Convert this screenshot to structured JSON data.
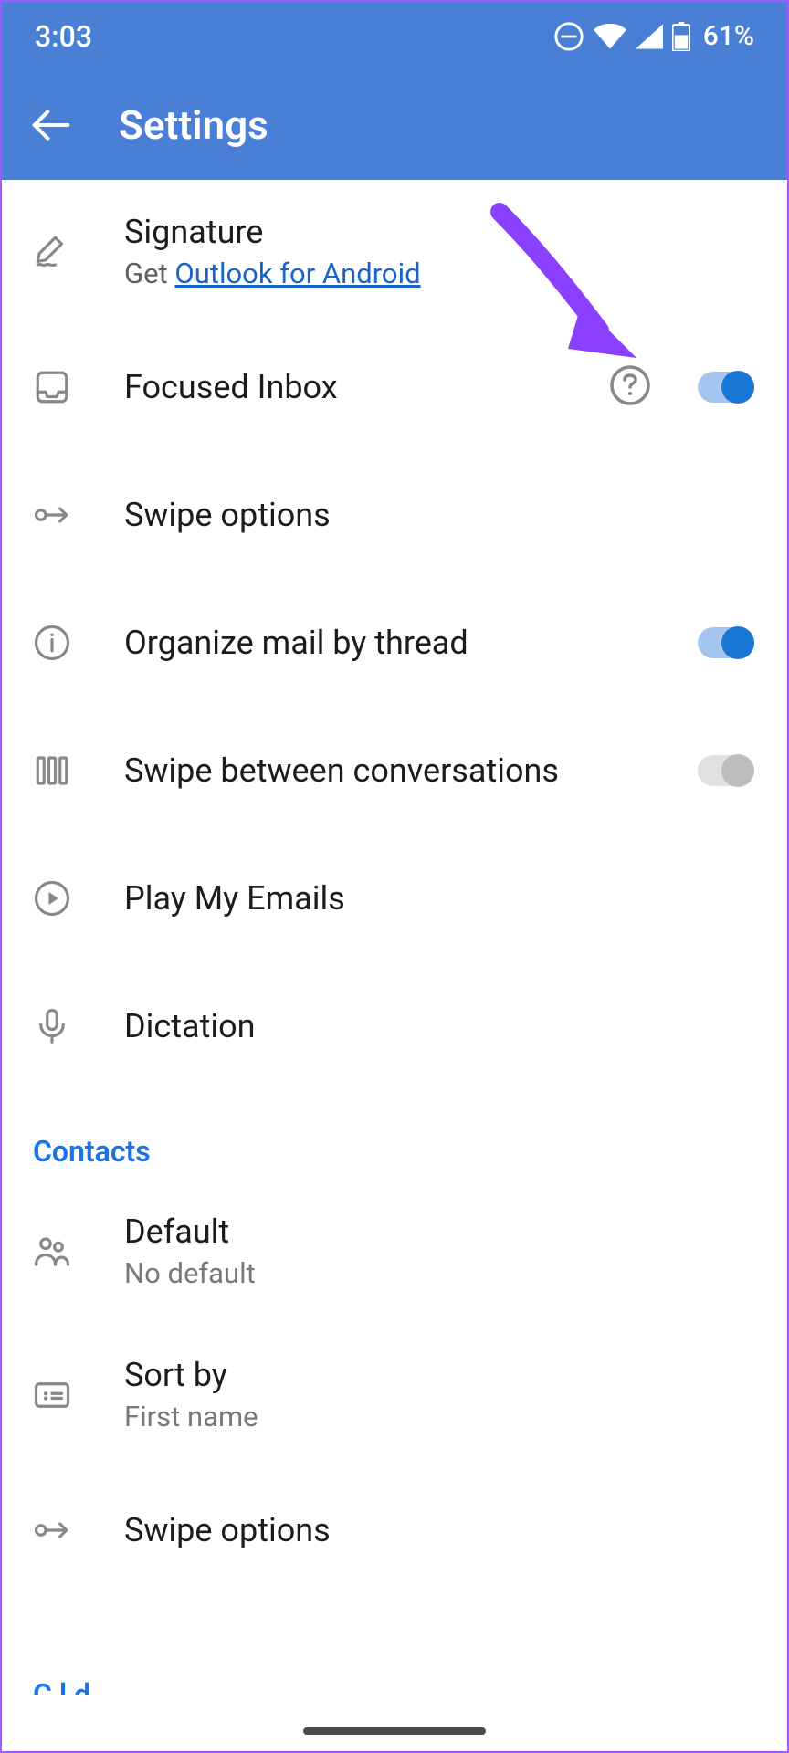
{
  "status": {
    "time": "3:03",
    "battery": "61%"
  },
  "header": {
    "title": "Settings"
  },
  "settings": {
    "signature": {
      "title": "Signature",
      "sub_pre": "Get ",
      "sub_link": "Outlook for Android"
    },
    "focused": {
      "title": "Focused Inbox"
    },
    "swipe": {
      "title": "Swipe options"
    },
    "thread": {
      "title": "Organize mail by thread"
    },
    "swipe_conv": {
      "title": "Swipe between conversations"
    },
    "play": {
      "title": "Play My Emails"
    },
    "dictation": {
      "title": "Dictation"
    }
  },
  "sections": {
    "contacts": "Contacts",
    "calendar": "Calendar"
  },
  "contacts": {
    "default": {
      "title": "Default",
      "sub": "No default"
    },
    "sort": {
      "title": "Sort by",
      "sub": "First name"
    },
    "swipe": {
      "title": "Swipe options"
    }
  },
  "toggles": {
    "focused": true,
    "thread": true,
    "swipe_conv": false
  }
}
